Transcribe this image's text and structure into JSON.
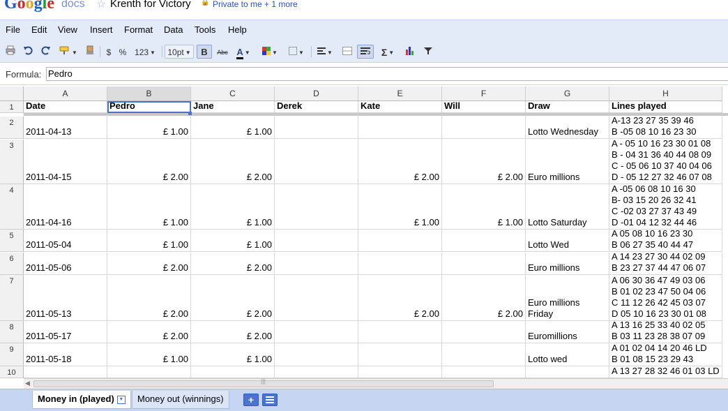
{
  "header": {
    "brand_google": "Google",
    "brand_docs": "docs",
    "doc_title": "Krenth for Victory",
    "sharing": "Private to me + 1 more"
  },
  "menu": [
    "File",
    "Edit",
    "View",
    "Insert",
    "Format",
    "Data",
    "Tools",
    "Help"
  ],
  "toolbar": {
    "currency": "$",
    "percent": "%",
    "number_format": "123",
    "font_size": "10pt",
    "bold": "B",
    "strikethrough": "Abc",
    "text_color": "A",
    "sum": "Σ",
    "icons": [
      "print-icon",
      "undo-icon",
      "redo-icon",
      "paint-format-icon",
      "clear-format-icon",
      "text-color-icon",
      "fill-color-icon",
      "borders-icon",
      "align-icon",
      "merge-icon",
      "wrap-icon",
      "sum-icon",
      "chart-icon",
      "filter-icon"
    ]
  },
  "formula_bar": {
    "label": "Formula:",
    "value": "Pedro"
  },
  "columns": [
    "A",
    "B",
    "C",
    "D",
    "E",
    "F",
    "G",
    "H"
  ],
  "selected_column": "B",
  "rows": [
    {
      "num": "1",
      "cells": [
        "Date",
        "Pedro",
        "Jane",
        "Derek",
        "Kate",
        "Will",
        "Draw",
        [
          "Lines played"
        ]
      ]
    },
    {
      "num": "2",
      "cells": [
        "2011-04-13",
        "£ 1.00",
        "£ 1.00",
        "",
        "",
        "",
        "Lotto Wednesday",
        [
          "A-13 23 27 35 39 46",
          "B -05 08 10 16 23 30"
        ]
      ]
    },
    {
      "num": "3",
      "cells": [
        "2011-04-15",
        "£ 2.00",
        "£ 2.00",
        "",
        "£ 2.00",
        "£ 2.00",
        "Euro millions",
        [
          "A - 05 10 16 23 30 01 08",
          "B - 04 31 36 40 44 08 09",
          "C - 05 06 10 37 40 04 06",
          "D - 05 12 27 32 46 07 08"
        ]
      ]
    },
    {
      "num": "4",
      "cells": [
        "2011-04-16",
        "£ 1.00",
        "£ 1.00",
        "",
        "£ 1.00",
        "£ 1.00",
        "Lotto Saturday",
        [
          "A -05 06 08 10 16 30",
          "B- 03 15 20 26 32 41",
          "C -02 03 27 37 43 49",
          "D -01 04 12 32 44 46"
        ]
      ]
    },
    {
      "num": "5",
      "cells": [
        "2011-05-04",
        "£ 1.00",
        "£ 1.00",
        "",
        "",
        "",
        "Lotto Wed",
        [
          "A 05 08 10 16 23 30",
          "B 06 27 35 40 44 47"
        ]
      ]
    },
    {
      "num": "6",
      "cells": [
        "2011-05-06",
        "£ 2.00",
        "£ 2.00",
        "",
        "",
        "",
        "Euro millions",
        [
          "A 14 23 27 30 44 02 09",
          "B 23 27 37 44 47 06 07"
        ]
      ]
    },
    {
      "num": "7",
      "cells": [
        "2011-05-13",
        "£ 2.00",
        "£ 2.00",
        "",
        "£ 2.00",
        "£ 2.00",
        [
          "Euro millions",
          "Friday"
        ],
        [
          "A 06 30 36 47 49 03 06",
          "B 01 02 23 47 50 04 06",
          "C 11 12 26 42 45 03 07",
          "D 05 10 16 23 30 01 08"
        ]
      ]
    },
    {
      "num": "8",
      "cells": [
        "2011-05-17",
        "£ 2.00",
        "£ 2.00",
        "",
        "",
        "",
        "Euromillions",
        [
          "A 13 16 25 33 40 02 05",
          "B 03 11 23 28 38 07 09"
        ]
      ]
    },
    {
      "num": "9",
      "cells": [
        "2011-05-18",
        "£ 1.00",
        "£ 1.00",
        "",
        "",
        "",
        "Lotto wed",
        [
          "A 01 02 04 14 20 46 LD",
          "B 01 08 15 23 29 43"
        ]
      ]
    },
    {
      "num": "10",
      "cells": [
        "",
        "",
        "",
        "",
        "",
        "",
        "",
        [
          "A 13 27 28 32 46 01 03 LD"
        ]
      ]
    }
  ],
  "sheet_tabs": [
    "Money in (played)",
    "Money out (winnings)"
  ],
  "colors": {
    "menubar_bg": "#e4ebf8",
    "selection": "#4b72c9",
    "tabbar_bg": "#c5d5f2"
  }
}
